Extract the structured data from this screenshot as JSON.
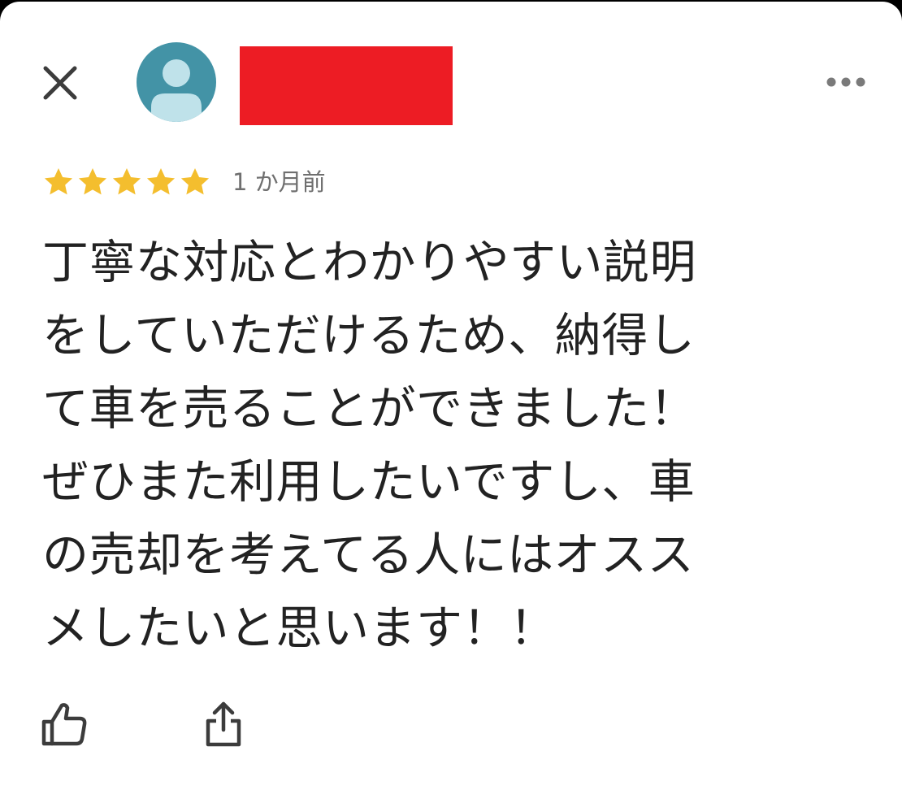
{
  "review": {
    "time_ago": "1 か月前",
    "rating": 5,
    "max_rating": 5,
    "text_lines": [
      "丁寧な対応とわかりやすい説明",
      "をしていただけるため、納得し",
      "て車を売ることができました！",
      "ぜひまた利用したいですし、車",
      "の売却を考えてる人にはオスス",
      "メしたいと思います！！"
    ]
  },
  "icons": {
    "close": "close-icon",
    "avatar": "person-icon",
    "more": "more-horizontal-icon",
    "star": "star-icon",
    "like": "thumb-up-icon",
    "share": "share-icon"
  },
  "colors": {
    "background": "#ffffff",
    "star": "#f4be2e",
    "avatar_bg": "#4393a6",
    "avatar_fg": "#bfe2ea",
    "redaction": "#ed1c24",
    "text": "#222222",
    "muted_text": "#6f6f6f",
    "icon": "#3c3c3c"
  }
}
